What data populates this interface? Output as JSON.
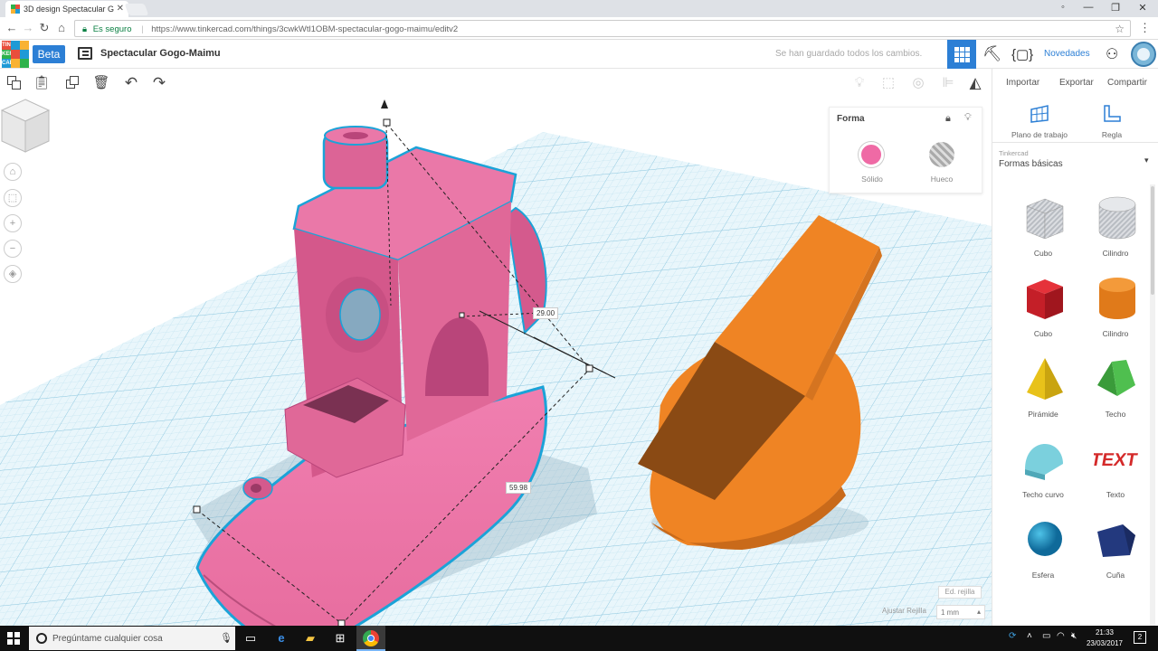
{
  "browser": {
    "tab_title": "3D design Spectacular G",
    "secure_label": "Es seguro",
    "url": "https://www.tinkercad.com/things/3cwkWtl1OBM-spectacular-gogo-maimu/editv2"
  },
  "app": {
    "logo_letters": [
      "TIN",
      "KER",
      "CAD"
    ],
    "badge": "Beta",
    "design_title": "Spectacular Gogo-Maimu",
    "save_status": "Se han guardado todos los cambios.",
    "news_label": "Novedades"
  },
  "actions": {
    "import": "Importar",
    "export": "Exportar",
    "share": "Compartir"
  },
  "shape_inspector": {
    "title": "Forma",
    "solid_label": "Sólido",
    "hole_label": "Hueco",
    "solid_color": "#ef6aa5"
  },
  "dimensions": {
    "height_value": "29.00",
    "length_value": "59.98"
  },
  "grid": {
    "edit_label": "Ed. rejilla",
    "snap_label": "Ajustar Rejilla",
    "snap_value": "1 mm"
  },
  "sidebar": {
    "workplane_label": "Plano de trabajo",
    "ruler_label": "Regla",
    "library_caption": "Tinkercad",
    "library_title": "Formas básicas",
    "shapes": [
      {
        "name": "Cubo",
        "kind": "box-hole"
      },
      {
        "name": "Cilindro",
        "kind": "cylinder-hole"
      },
      {
        "name": "Cubo",
        "kind": "box-red"
      },
      {
        "name": "Cilindro",
        "kind": "cylinder-orange"
      },
      {
        "name": "Pirámide",
        "kind": "pyramid"
      },
      {
        "name": "Techo",
        "kind": "roof"
      },
      {
        "name": "Techo curvo",
        "kind": "curved-roof"
      },
      {
        "name": "Texto",
        "kind": "text"
      },
      {
        "name": "Esfera",
        "kind": "sphere"
      },
      {
        "name": "Cuña",
        "kind": "wedge"
      }
    ]
  },
  "taskbar": {
    "search_placeholder": "Pregúntame cualquier cosa",
    "time": "21:33",
    "date": "23/03/2017",
    "notifications": "2"
  },
  "colors": {
    "accent": "#2c7fd5",
    "boat": "#ec7ba6",
    "orange_shape": "#ef8424",
    "grid_line": "#9fd0e6"
  }
}
